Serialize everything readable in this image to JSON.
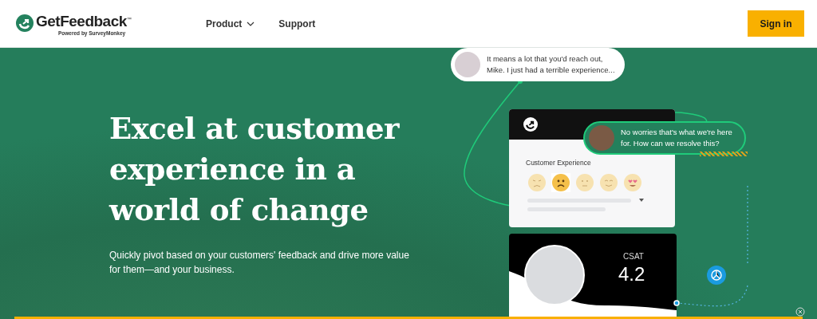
{
  "header": {
    "logo": "GetFeedback",
    "logo_tagline": "Powered by SurveyMonkey",
    "trademark": "™",
    "nav": [
      {
        "label": "Product",
        "dropdown": true
      },
      {
        "label": "Support",
        "dropdown": false
      }
    ],
    "cta": "Sign in"
  },
  "hero": {
    "heading": "Excel at customer experience in a world of change",
    "subtitle": "Quickly pivot based on your customers' feedback and drive more value for them—and your business."
  },
  "chat": [
    {
      "kind": "customer",
      "text": "It means a lot that you'd reach out, Mike. I just had a terrible experience..."
    },
    {
      "kind": "agent",
      "text": "No worries that's what we're here for. How can we resolve this?"
    }
  ],
  "survey": {
    "title": "Customer Experience",
    "faces": [
      {
        "kind": "angry",
        "selected": false
      },
      {
        "kind": "worried",
        "selected": true
      },
      {
        "kind": "neutral",
        "selected": false
      },
      {
        "kind": "happy",
        "selected": false
      },
      {
        "kind": "love",
        "selected": false
      }
    ]
  },
  "csat": {
    "label": "CSAT",
    "value": "4.2"
  }
}
